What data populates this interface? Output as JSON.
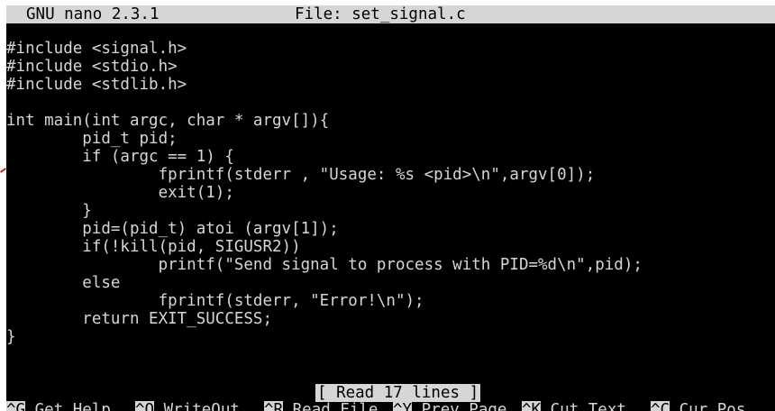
{
  "title_bar": {
    "version": "GNU nano 2.3.1",
    "file": "File: set_signal.c"
  },
  "code_lines": [
    "#include <signal.h>",
    "#include <stdio.h>",
    "#include <stdlib.h>",
    "",
    "int main(int argc, char * argv[]){",
    "        pid_t pid;",
    "        if (argc == 1) {",
    "                fprintf(stderr , \"Usage: %s <pid>\\n\",argv[0]);",
    "                exit(1);",
    "        }",
    "        pid=(pid_t) atoi (argv[1]);",
    "        if(!kill(pid, SIGUSR2))",
    "                printf(\"Send signal to process with PID=%d\\n\",pid);",
    "        else",
    "                fprintf(stderr, \"Error!\\n\");",
    "        return EXIT_SUCCESS;",
    "}"
  ],
  "status_message": "[ Read 17 lines ]",
  "shortcuts": [
    {
      "key": "^G",
      "label": "Get Help"
    },
    {
      "key": "^O",
      "label": "WriteOut"
    },
    {
      "key": "^R",
      "label": "Read File"
    },
    {
      "key": "^Y",
      "label": "Prev Page"
    },
    {
      "key": "^K",
      "label": "Cut Text"
    },
    {
      "key": "^C",
      "label": "Cur Pos"
    }
  ]
}
